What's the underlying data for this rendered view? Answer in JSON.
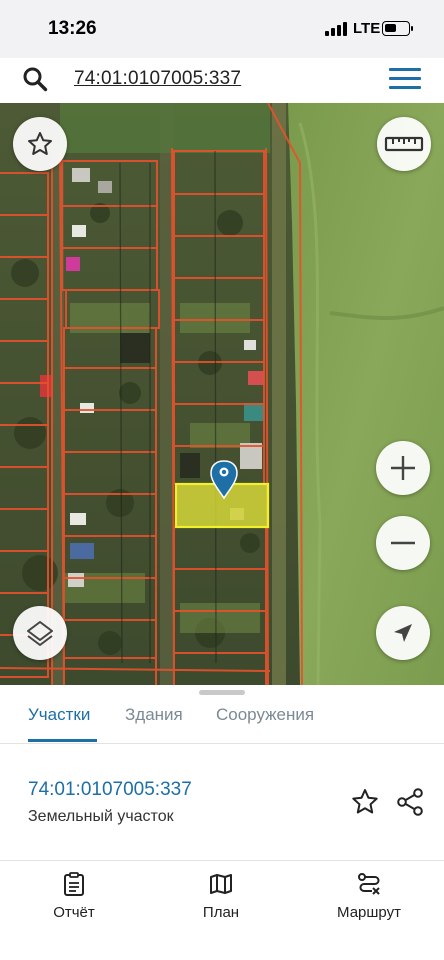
{
  "status_bar": {
    "time": "13:26",
    "network": "LTE"
  },
  "search": {
    "query": "74:01:0107005:337"
  },
  "map": {
    "icons": [
      "star-icon",
      "ruler-icon",
      "zoom-in-icon",
      "zoom-out-icon",
      "layers-icon",
      "location-arrow-icon",
      "map-pin-icon"
    ],
    "colors": {
      "parcel_border": "#e8512c",
      "selected_parcel": "#e8e83a",
      "pin": "#1d6fa5"
    }
  },
  "tabs": [
    {
      "label": "Участки",
      "active": true
    },
    {
      "label": "Здания",
      "active": false
    },
    {
      "label": "Сооружения",
      "active": false
    }
  ],
  "parcel": {
    "id": "74:01:0107005:337",
    "type": "Земельный участок"
  },
  "bottom_nav": [
    {
      "label": "Отчёт",
      "icon": "report-icon"
    },
    {
      "label": "План",
      "icon": "map-icon"
    },
    {
      "label": "Маршрут",
      "icon": "route-icon"
    }
  ],
  "accent_color": "#1d6fa5"
}
